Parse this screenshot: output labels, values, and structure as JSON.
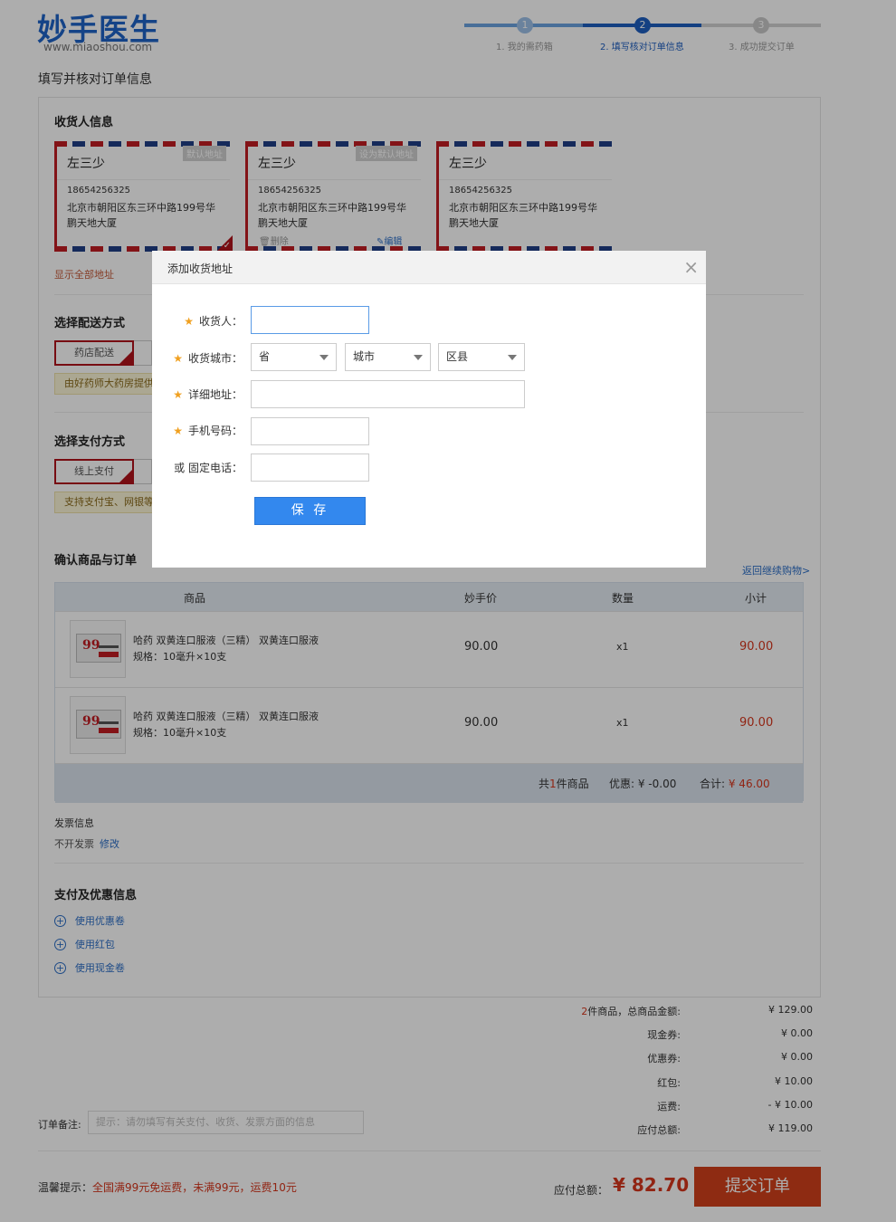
{
  "header": {
    "logo_cn": "妙手医生",
    "logo_en": "www.miaoshou.com",
    "steps": [
      {
        "num": "1",
        "label": "1. 我的需药箱"
      },
      {
        "num": "2",
        "label": "2. 填写核对订单信息"
      },
      {
        "num": "3",
        "label": "3. 成功提交订单"
      }
    ],
    "colors": {
      "brand": "#1e63c8",
      "step_done": "#6aa3e0",
      "step_active": "#1e5fc0",
      "step_todo": "#d2d2d2"
    }
  },
  "page_title": "填写并核对订单信息",
  "address": {
    "section_title": "收货人信息",
    "cards": [
      {
        "name": "左三少",
        "phone": "18654256325",
        "addr": "北京市朝阳区东三环中路199号华鹏天地大厦",
        "tag": "默认地址"
      },
      {
        "name": "左三少",
        "phone": "18654256325",
        "addr": "北京市朝阳区东三环中路199号华鹏天地大厦",
        "tag": "设为默认地址",
        "delete": "删除",
        "edit": "编辑"
      },
      {
        "name": "左三少",
        "phone": "18654256325",
        "addr": "北京市朝阳区东三环中路199号华鹏天地大厦"
      }
    ],
    "show_all": "显示全部地址"
  },
  "delivery": {
    "section_title": "选择配送方式",
    "option": "药店配送",
    "tip": "由好药师大药房提供"
  },
  "payment": {
    "section_title": "选择支付方式",
    "option": "线上支付",
    "tip": "支持支付宝、网银等"
  },
  "order": {
    "section_title": "确认商品与订单",
    "back_link": "返回继续购物>",
    "headers": [
      "商品",
      "妙手价",
      "数量",
      "小计"
    ],
    "items": [
      {
        "name": "哈药 双黄连口服液（三精） 双黄连口服液",
        "spec": "规格：10毫升×10支",
        "price": "90.00",
        "qty": "x1",
        "subtotal": "90.00",
        "img_label": "99"
      },
      {
        "name": "哈药 双黄连口服液（三精） 双黄连口服液",
        "spec": "规格：10毫升×10支",
        "price": "90.00",
        "qty": "x1",
        "subtotal": "90.00",
        "img_label": "99"
      }
    ],
    "footer": {
      "count_prefix": "共",
      "count": "1",
      "count_suffix": "件商品",
      "discount": "优惠: ¥ -0.00",
      "total_label": "合计: ",
      "total": "¥ 46.00"
    }
  },
  "invoice": {
    "label": "发票信息",
    "value": "不开发票",
    "edit": "修改"
  },
  "promo": {
    "section_title": "支付及优惠信息",
    "items": [
      "使用优惠卷",
      "使用红包",
      "使用现金卷"
    ]
  },
  "summary": {
    "rows": [
      {
        "label_prefix": "2",
        "label": "件商品，总商品金额:",
        "value": "¥ 129.00"
      },
      {
        "label": "现金券:",
        "value": "¥ 0.00"
      },
      {
        "label": "优惠券:",
        "value": "¥ 0.00"
      },
      {
        "label": "红包:",
        "value": "¥ 10.00"
      },
      {
        "label": "运费:",
        "value": "- ¥ 10.00"
      },
      {
        "label": "应付总额:",
        "value": "¥ 119.00"
      }
    ],
    "remark_label": "订单备注:",
    "remark_placeholder": "提示：请勿填写有关支付、收货、发票方面的信息"
  },
  "bottom": {
    "tip_label": "温馨提示：",
    "tip_text": "全国满99元免运费，未满99元，运费10元",
    "payable_label": "应付总额：",
    "payable": "¥ 82.70",
    "submit": "提交订单"
  },
  "modal": {
    "title": "添加收货地址",
    "close": "×",
    "fields": {
      "receiver": "收货人：",
      "city": "收货城市：",
      "detail": "详细地址：",
      "mobile": "手机号码：",
      "phone": "或 固定电话："
    },
    "selects": {
      "province": "省",
      "city": "城市",
      "district": "区县"
    },
    "save": "保 存"
  }
}
